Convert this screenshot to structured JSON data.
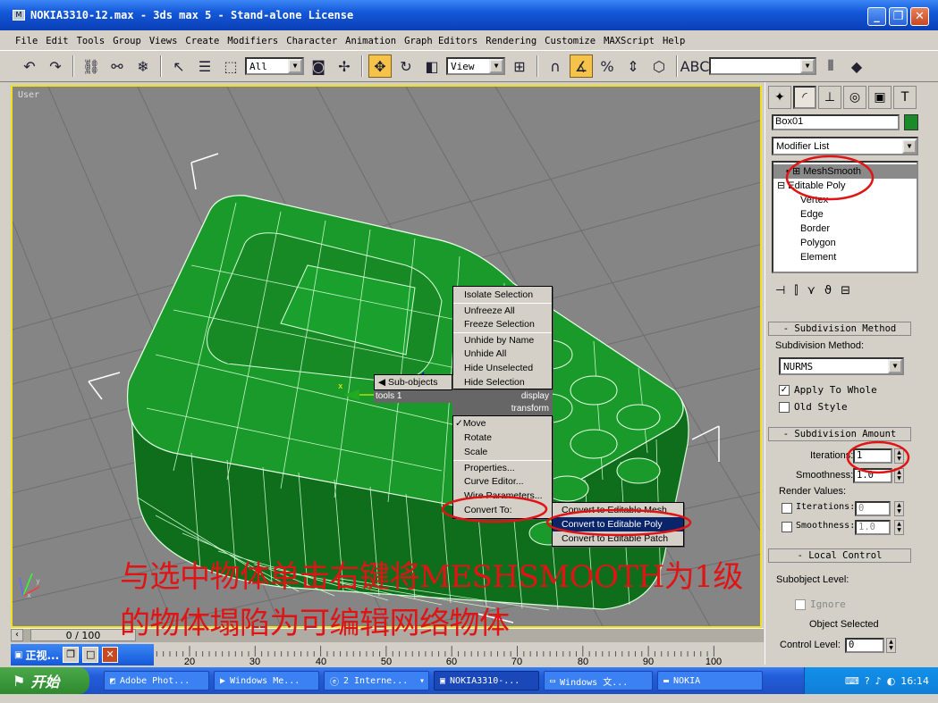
{
  "window": {
    "title": "NOKIA3310-12.max - 3ds max 5 - Stand-alone License"
  },
  "menu": [
    "File",
    "Edit",
    "Tools",
    "Group",
    "Views",
    "Create",
    "Modifiers",
    "Character",
    "Animation",
    "Graph Editors",
    "Rendering",
    "Customize",
    "MAXScript",
    "Help"
  ],
  "toolbar": {
    "selection_filter": "All",
    "ref_coord": "View"
  },
  "viewport": {
    "label": "User"
  },
  "panel": {
    "object_name": "Box01",
    "modifier_list": "Modifier List",
    "stack": {
      "meshsmooth": "MeshSmooth",
      "editable_poly": "Editable Poly",
      "vertex": "Vertex",
      "edge": "Edge",
      "border": "Border",
      "polygon": "Polygon",
      "element": "Element"
    },
    "subdivision_method": {
      "header": "Subdivision Method",
      "method_label": "Subdivision Method:",
      "method_value": "NURMS",
      "apply_to_whole": "Apply To Whole",
      "old_style": "Old Style"
    },
    "subdivision_amount": {
      "header": "Subdivision Amount",
      "iterations_label": "Iterations:",
      "iterations_value": "1",
      "smoothness_label": "Smoothness:",
      "smoothness_value": "1.0",
      "render_values": "Render Values:",
      "render_iterations_label": "Iterations:",
      "render_iterations_value": "0",
      "render_smoothness_label": "Smoothness:",
      "render_smoothness_value": "1.0"
    },
    "local_control": {
      "header": "Local Control",
      "subobject_level": "Subobject Level:",
      "ignore": "Ignore",
      "object_selected": "Object Selected",
      "control_level_label": "Control Level:",
      "control_level_value": "0"
    }
  },
  "context_menu": {
    "sub_objects": "Sub-objects",
    "tools1": "tools 1",
    "display": "display",
    "transform": "transform",
    "display_items": [
      "Isolate Selection",
      "Unfreeze All",
      "Freeze Selection",
      "Unhide by Name",
      "Unhide All",
      "Hide Unselected",
      "Hide Selection"
    ],
    "transform_items": [
      "Move",
      "Rotate",
      "Scale",
      "Properties...",
      "Curve Editor...",
      "Wire Parameters...",
      "Convert To:"
    ],
    "convert_sub": [
      "Convert to Editable Mesh",
      "Convert to Editable Poly",
      "Convert to Editable Patch"
    ]
  },
  "timeline": {
    "frame": "0 / 100",
    "ticks": [
      "20",
      "30",
      "40",
      "50",
      "60",
      "70",
      "80",
      "90",
      "100"
    ]
  },
  "subwindow": {
    "title": "正视..."
  },
  "taskbar": {
    "start": "开始",
    "tasks": [
      "Adobe Phot...",
      "Windows Me...",
      "2 Interne...",
      "NOKIA3310-...",
      "Windows 文...",
      "NOKIA"
    ],
    "clock": "16:14"
  },
  "annotation": {
    "line1": "与选中物体单击右键将MESHSMOOTH为1级",
    "line2": "的物体塌陷为可编辑网络物体"
  },
  "colors": {
    "viewport_bg": "#858585",
    "model": "#1a8a2a",
    "annotation": "#e01414",
    "selection_border": "#f0e020"
  }
}
